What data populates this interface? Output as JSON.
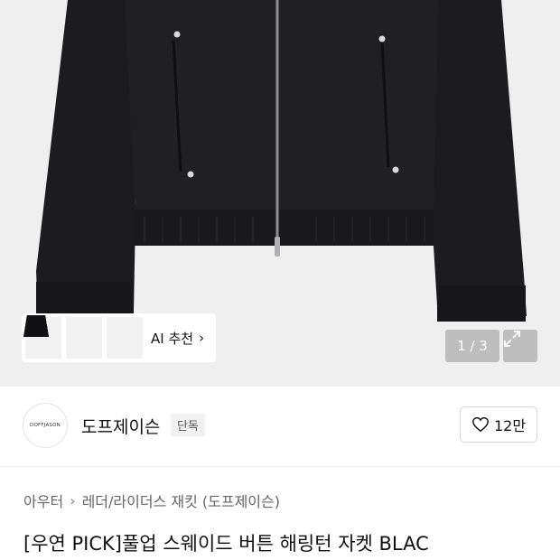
{
  "gallery": {
    "counter": "1 / 3",
    "ai_recommend_label": "AI 추천",
    "ai_chevron": "›",
    "expand_icon": "expand-icon"
  },
  "brand": {
    "logo_text": "DOFFJASON",
    "name": "도프제이슨",
    "badge": "단독"
  },
  "like": {
    "count": "12만",
    "icon": "heart-icon"
  },
  "breadcrumb": {
    "items": [
      "아우터",
      "레더/라이더스 재킷 (도프제이슨)"
    ],
    "separator": "›"
  },
  "product": {
    "title": "[우연 PICK]풀업 스웨이드 버튼 해링턴 자켓 BLAC"
  },
  "colors": {
    "background": "#efefef",
    "jacket": "#1d1d1f",
    "overlay": "rgba(150,150,150,0.55)"
  }
}
